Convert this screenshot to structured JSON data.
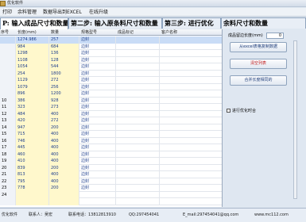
{
  "window": {
    "title": "优化软件"
  },
  "menu": [
    {
      "label": "打印"
    },
    {
      "label": "余料管理"
    },
    {
      "label": "数据导出到EXCEL"
    },
    {
      "label": "在线升级"
    }
  ],
  "tabs": [
    {
      "label": "P: 输入成品尺寸和数量"
    },
    {
      "label": "第二步: 输入原条料尺寸和数量"
    },
    {
      "label": "第三步: 进行优化"
    },
    {
      "label": "余料尺寸和数量"
    }
  ],
  "grid": {
    "headers": [
      "序号",
      "长度(mm)",
      "数量",
      "规格型号",
      "成品标记",
      "客户名称"
    ],
    "rows": [
      {
        "no": "",
        "len": "1274.986",
        "qty": "257",
        "spec": "边封",
        "sel": true
      },
      {
        "no": "",
        "len": "984",
        "qty": "684",
        "spec": "边封"
      },
      {
        "no": "",
        "len": "1298",
        "qty": "136",
        "spec": "边封"
      },
      {
        "no": "",
        "len": "1108",
        "qty": "128",
        "spec": "边封"
      },
      {
        "no": "",
        "len": "1054",
        "qty": "544",
        "spec": "边封"
      },
      {
        "no": "",
        "len": "254",
        "qty": "1800",
        "spec": "边封"
      },
      {
        "no": "",
        "len": "1129",
        "qty": "272",
        "spec": "边封"
      },
      {
        "no": "",
        "len": "1079",
        "qty": "256",
        "spec": "边封"
      },
      {
        "no": "",
        "len": "896",
        "qty": "1200",
        "spec": "边封"
      },
      {
        "no": "10",
        "len": "386",
        "qty": "928",
        "spec": "边封"
      },
      {
        "no": "11",
        "len": "323",
        "qty": "273",
        "spec": "边封"
      },
      {
        "no": "12",
        "len": "484",
        "qty": "400",
        "spec": "边封"
      },
      {
        "no": "13",
        "len": "420",
        "qty": "272",
        "spec": "边封"
      },
      {
        "no": "14",
        "len": "947",
        "qty": "200",
        "spec": "边封"
      },
      {
        "no": "15",
        "len": "715",
        "qty": "400",
        "spec": "边封"
      },
      {
        "no": "16",
        "len": "746",
        "qty": "400",
        "spec": "边封"
      },
      {
        "no": "17",
        "len": "445",
        "qty": "400",
        "spec": "边封"
      },
      {
        "no": "18",
        "len": "460",
        "qty": "400",
        "spec": "边封"
      },
      {
        "no": "19",
        "len": "410",
        "qty": "400",
        "spec": "边封"
      },
      {
        "no": "20",
        "len": "839",
        "qty": "200",
        "spec": "边封"
      },
      {
        "no": "21",
        "len": "813",
        "qty": "400",
        "spec": "边封"
      },
      {
        "no": "22",
        "len": "795",
        "qty": "400",
        "spec": "边封"
      },
      {
        "no": "23",
        "len": "778",
        "qty": "200",
        "spec": "边封"
      },
      {
        "no": "24",
        "len": "",
        "qty": "",
        "spec": ""
      },
      {
        "no": "",
        "len": "",
        "qty": "",
        "spec": ""
      }
    ]
  },
  "panel": {
    "margin_label": "成品留边长度(mm)",
    "margin_value": "0",
    "btn_import": "从excel表格复制数据",
    "btn_clear": "清空列表",
    "btn_merge": "合并长度相同的",
    "check_label": "进行优化时合"
  },
  "status": {
    "left": "优化软件",
    "contact": "联系人：吴宏",
    "phone": "联系电话：13812813910",
    "qq": "QQ:297454041",
    "email": "E_mail:297454041@qq.com",
    "site": "www.mc112.com"
  }
}
